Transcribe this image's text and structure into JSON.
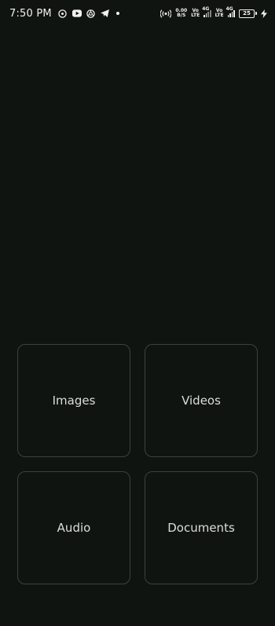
{
  "status_bar": {
    "time": "7:50 PM",
    "left_icons": [
      "location-pin-icon",
      "youtube-icon",
      "chrome-icon",
      "telegram-icon"
    ],
    "hotspot_icon": "hotspot-icon",
    "net_speed_value": "0.00",
    "net_speed_unit": "B/S",
    "sim1": {
      "volte_top": "Vo",
      "volte_bottom": "LTE",
      "network": "4G"
    },
    "sim2": {
      "volte_top": "Vo",
      "volte_bottom": "LTE",
      "network": "4G"
    },
    "battery_level": "25",
    "charging": true
  },
  "tiles": {
    "images": "Images",
    "videos": "Videos",
    "audio": "Audio",
    "documents": "Documents"
  },
  "colors": {
    "background": "#0f1411",
    "tile_border": "#3b423d",
    "text": "#dcdcdc"
  }
}
